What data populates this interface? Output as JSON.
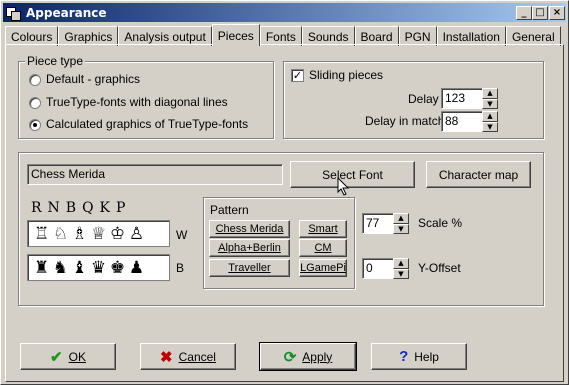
{
  "window": {
    "title": "Appearance"
  },
  "titlebar_buttons": [
    "_",
    "□",
    "×"
  ],
  "tabs": [
    "Colours",
    "Graphics",
    "Analysis output",
    "Pieces",
    "Fonts",
    "Sounds",
    "Board",
    "PGN",
    "Installation",
    "General"
  ],
  "active_tab": "Pieces",
  "piece_type": {
    "legend": "Piece type",
    "options": [
      "Default - graphics",
      "TrueType-fonts with diagonal lines",
      "Calculated graphics of TrueType-fonts"
    ],
    "selected": "Calculated graphics of TrueType-fonts"
  },
  "sliding": {
    "label": "Sliding pieces",
    "checked": true,
    "delay_label": "Delay",
    "delay_value": "123",
    "delay_match_label": "Delay in match",
    "delay_match_value": "88"
  },
  "font": {
    "name": "Chess Merida",
    "select_font_label": "Select Font",
    "character_map_label": "Character map"
  },
  "pieces": {
    "letters": "RNBQKP",
    "white_label": "W",
    "black_label": "B",
    "white_row": [
      "♖",
      "♘",
      "♗",
      "♕",
      "♔",
      "♙"
    ],
    "black_row": [
      "♜",
      "♞",
      "♝",
      "♛",
      "♚",
      "♟"
    ]
  },
  "pattern": {
    "legend": "Pattern",
    "buttons": [
      "Chess Merida",
      "Smart",
      "Alpha+Berlin",
      "CM",
      "Traveller",
      "LGamePi"
    ]
  },
  "scale": {
    "value": "77",
    "label": "Scale %"
  },
  "yoffset": {
    "value": "0",
    "label": "Y-Offset"
  },
  "bottom": {
    "ok": "OK",
    "cancel": "Cancel",
    "apply": "Apply",
    "help": "Help"
  },
  "icons": {
    "ok": "checkmark-icon",
    "cancel": "x-icon",
    "apply": "refresh-icon",
    "help": "question-icon"
  },
  "colors": {
    "titlebar_start": "#0a246a",
    "titlebar_end": "#a6caf0",
    "face": "#d4d0c8",
    "ok_green": "#1a9a1a",
    "cancel_red": "#c00000",
    "apply_green": "#188a30",
    "help_blue": "#1030c0"
  }
}
